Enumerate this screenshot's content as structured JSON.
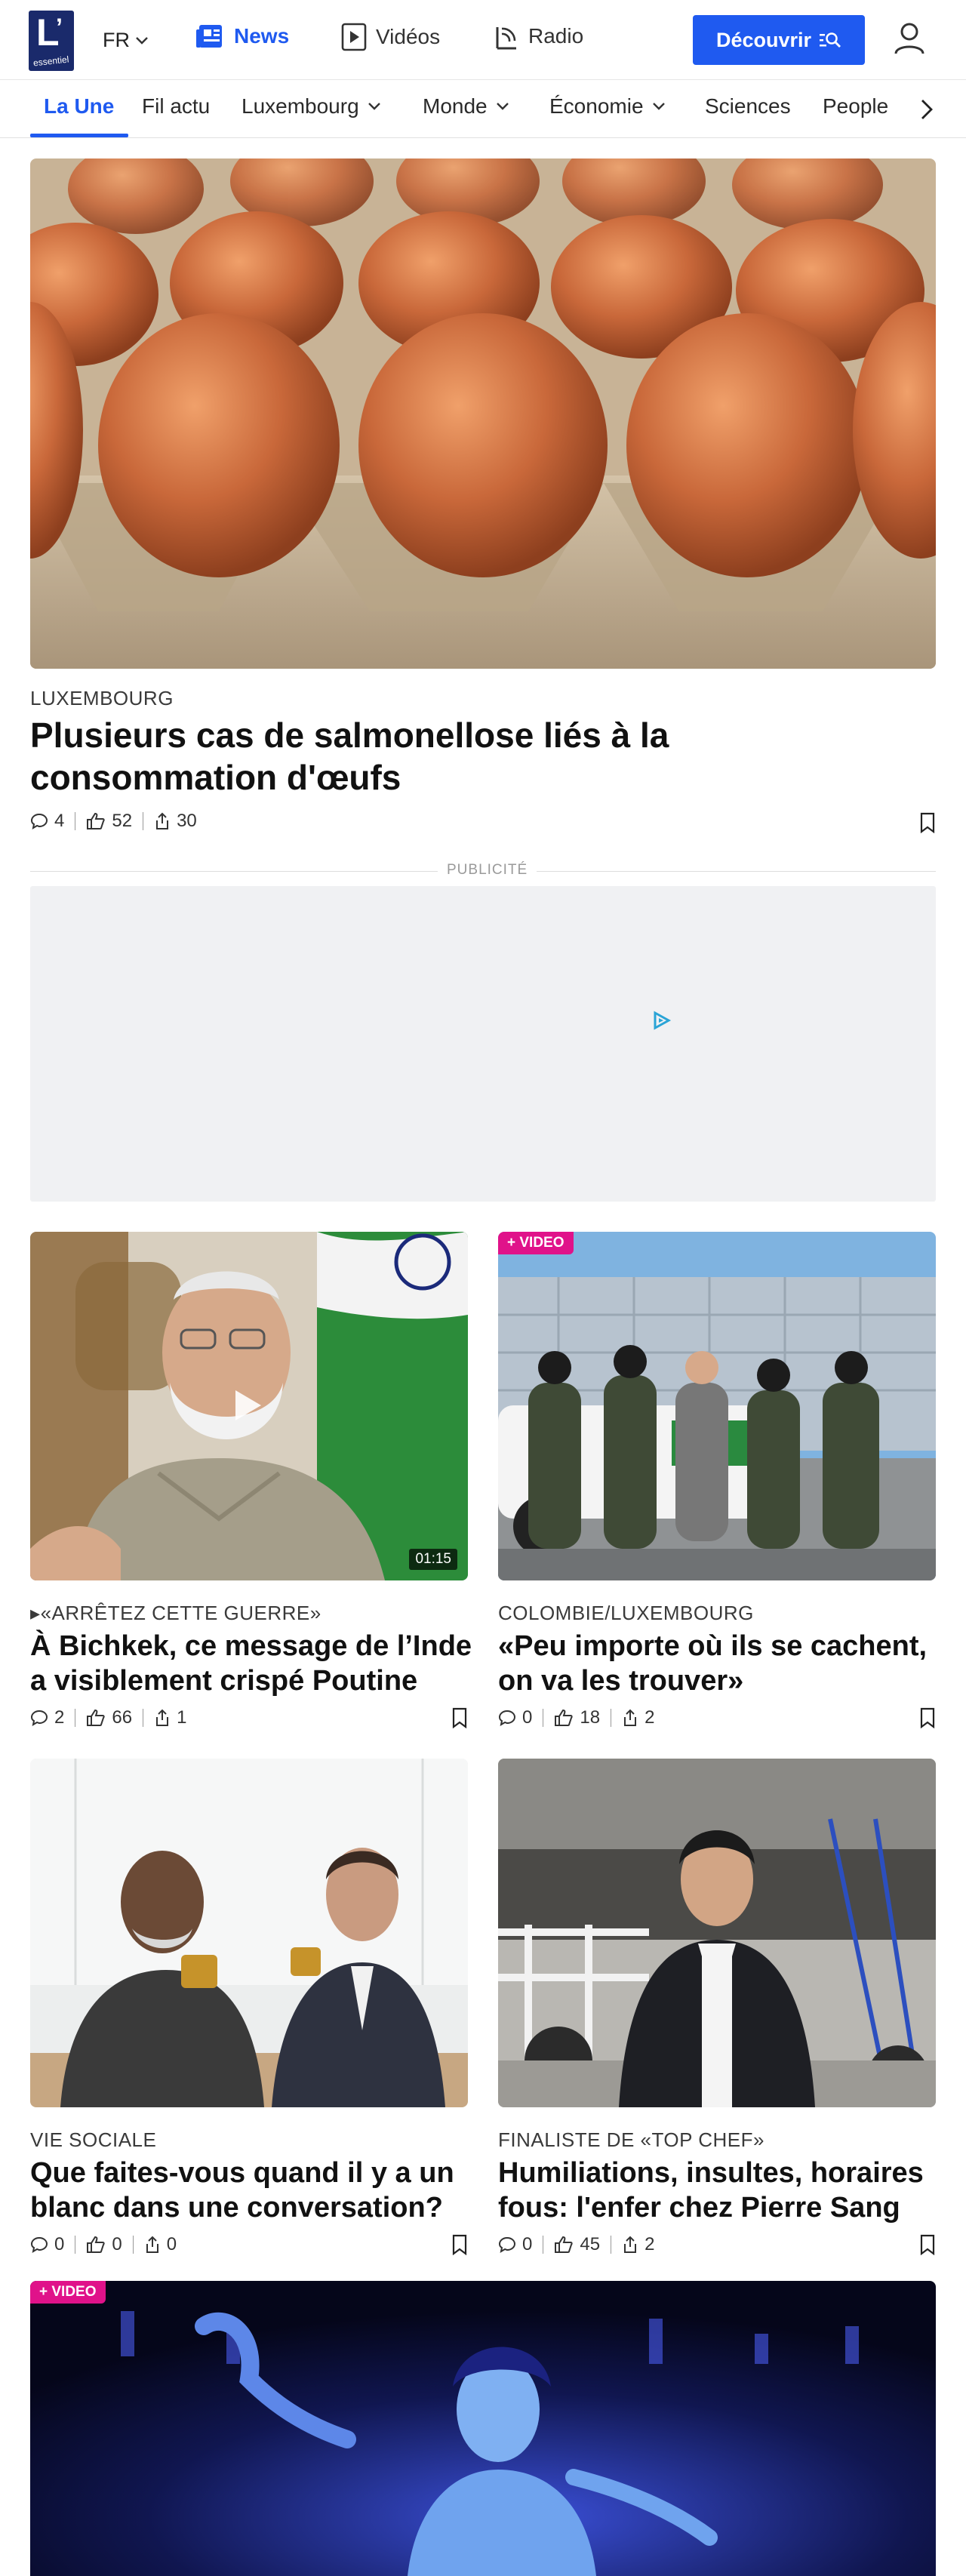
{
  "header": {
    "logo": {
      "mark": "L",
      "apostrophe": "’",
      "wordmark": "essentiel"
    },
    "language": "FR",
    "nav": [
      {
        "label": "News",
        "icon": "newspaper-icon",
        "active": true
      },
      {
        "label": "Vidéos",
        "icon": "play-icon"
      },
      {
        "label": "Radio",
        "icon": "radio-icon"
      }
    ],
    "discover_label": "Découvrir",
    "accent_color": "#1f5af0"
  },
  "categories": [
    {
      "label": "La Une",
      "active": true
    },
    {
      "label": "Fil actu"
    },
    {
      "label": "Luxembourg",
      "has_dropdown": true
    },
    {
      "label": "Monde",
      "has_dropdown": true
    },
    {
      "label": "Économie",
      "has_dropdown": true
    },
    {
      "label": "Sciences"
    },
    {
      "label": "People"
    }
  ],
  "hero": {
    "section": "LUXEMBOURG",
    "title_line1": "Plusieurs cas de salmonellose liés à la",
    "title_line2": "consommation d'œufs",
    "comments": "4",
    "likes": "52",
    "shares": "30"
  },
  "ad": {
    "label": "PUBLICITÉ"
  },
  "articles": [
    {
      "section": "«ARRÊTEZ CETTE GUERRE»",
      "title_line1": "À Bichkek, ce message de l’Inde",
      "title_line2": "a visiblement crispé Poutine",
      "comments": "2",
      "likes": "66",
      "shares": "1",
      "duration": "01:15"
    },
    {
      "tag": "+ VIDEO",
      "section": "COLOMBIE/LUXEMBOURG",
      "title_line1": "«Peu importe où ils se cachent,",
      "title_line2": "on va les trouver»",
      "comments": "0",
      "likes": "18",
      "shares": "2"
    },
    {
      "section": "VIE SOCIALE",
      "title_line1": "Que faites-vous quand il y a un",
      "title_line2": "blanc dans une conversation?",
      "comments": "0",
      "likes": "0",
      "shares": "0"
    },
    {
      "section": "FINALISTE DE «TOP CHEF»",
      "title_line1": "Humiliations, insultes, horaires",
      "title_line2": "fous: l'enfer chez Pierre Sang",
      "comments": "0",
      "likes": "45",
      "shares": "2"
    },
    {
      "tag": "+ VIDEO"
    }
  ]
}
